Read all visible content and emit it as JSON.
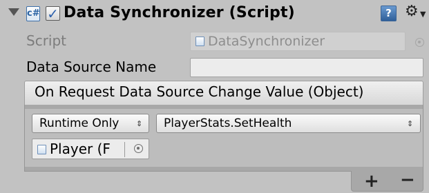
{
  "component": {
    "title": "Data Synchronizer (Script)",
    "script_icon_glyph": "c#",
    "help_icon_glyph": "?",
    "gear_icon_glyph": "⚙",
    "checkbox_checked": true,
    "foldout_expanded": true
  },
  "fields": {
    "script": {
      "label": "Script",
      "value": "DataSynchronizer"
    },
    "data_source_name": {
      "label": "Data Source Name",
      "value": ""
    }
  },
  "event": {
    "title": "On Request Data Source Change Value (Object)",
    "call_state": {
      "value": "Runtime Only",
      "arrow": "⇕"
    },
    "function": {
      "value": "PlayerStats.SetHealth",
      "arrow": "⇕"
    },
    "target_object": "Player (F",
    "add_label": "+",
    "remove_label": "−"
  },
  "colors": {
    "panel_bg": "#c2c2c2",
    "script_icon_blue": "#2c64a4",
    "help_icon_blue": "#2f5f99"
  },
  "icons": [
    "foldout-arrow-icon",
    "script-icon",
    "checkbox-icon",
    "help-icon",
    "gear-icon",
    "object-picker-icon"
  ]
}
